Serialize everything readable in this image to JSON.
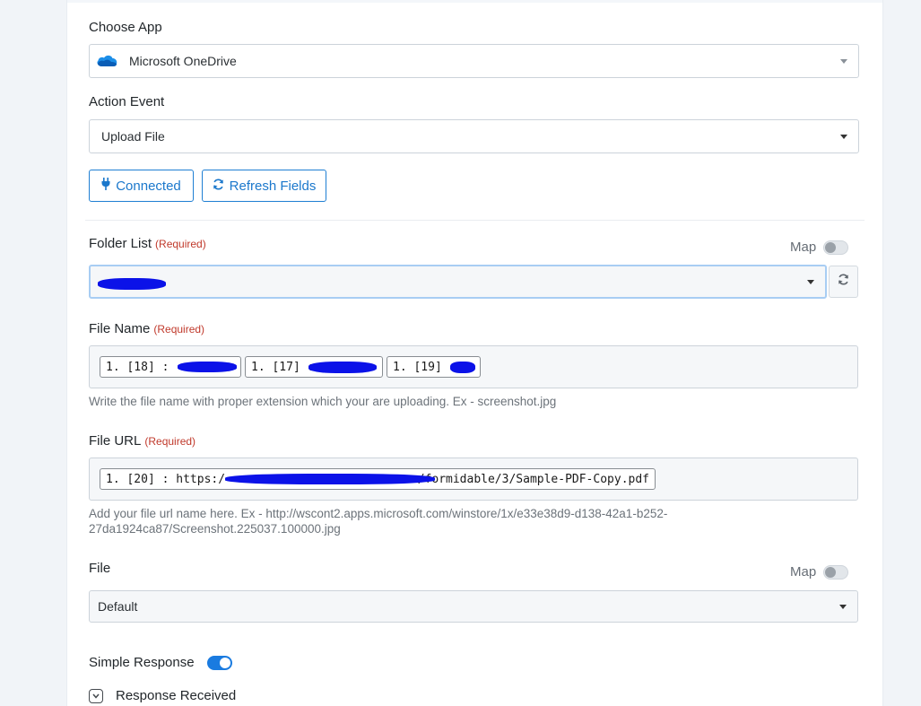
{
  "choose_app": {
    "label": "Choose App",
    "selected": "Microsoft OneDrive",
    "icon": "onedrive-cloud-icon"
  },
  "action_event": {
    "label": "Action Event",
    "selected": "Upload File"
  },
  "buttons": {
    "connected": "Connected",
    "refresh_fields": "Refresh Fields"
  },
  "folder_list": {
    "label": "Folder List",
    "required": "(Required)",
    "map_label": "Map",
    "map_on": false,
    "value_redacted": true
  },
  "file_name": {
    "label": "File Name",
    "required": "(Required)",
    "chips": [
      "1. [18] :",
      "1. [17] :",
      "1. [19] :"
    ],
    "help": "Write the file name with proper extension which your are uploading. Ex - screenshot.jpg"
  },
  "file_url": {
    "label": "File URL",
    "required": "(Required)",
    "chip_prefix": "1. [20] : https:/",
    "chip_suffix": "/formidable/3/Sample-PDF-Copy.pdf",
    "help_line1": "Add your file url name here. Ex - http://wscont2.apps.microsoft.com/winstore/1x/e33e38d9-d138-42a1-b252-",
    "help_line2": "27da1924ca87/Screenshot.225037.100000.jpg"
  },
  "file": {
    "label": "File",
    "map_label": "Map",
    "map_on": false,
    "selected": "Default"
  },
  "simple_response": {
    "label": "Simple Response",
    "on": true
  },
  "response_received": {
    "label": "Response Received"
  },
  "colors": {
    "accent": "#1b78cc",
    "required": "#c0392b",
    "redaction": "#0b12e8"
  }
}
